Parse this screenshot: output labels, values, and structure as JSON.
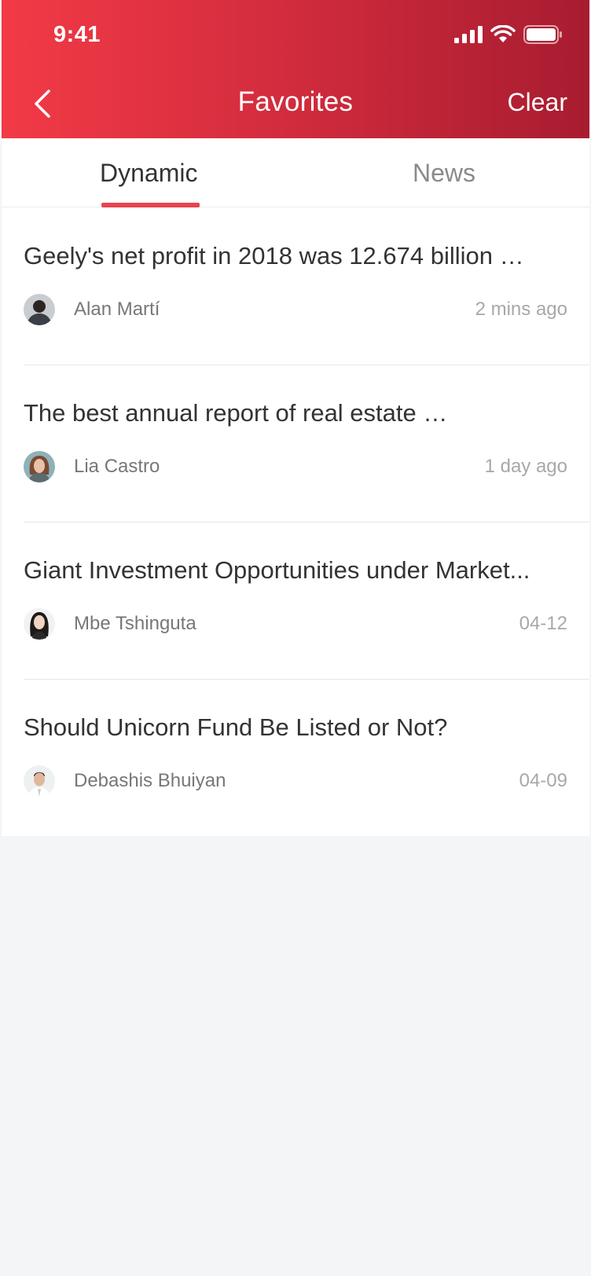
{
  "status_bar": {
    "time": "9:41"
  },
  "nav": {
    "title": "Favorites",
    "action": "Clear"
  },
  "tabs": [
    {
      "label": "Dynamic",
      "active": true
    },
    {
      "label": "News",
      "active": false
    }
  ],
  "items": [
    {
      "title": "Geely's net profit in 2018 was 12.674 billion …",
      "author": "Alan Martí",
      "time": "2 mins ago"
    },
    {
      "title": "The best annual report of real estate …",
      "author": "Lia Castro",
      "time": "1 day ago"
    },
    {
      "title": "Giant Investment Opportunities under Market...",
      "author": "Mbe Tshinguta",
      "time": "04-12"
    },
    {
      "title": "Should Unicorn Fund Be Listed or Not?",
      "author": "Debashis Bhuiyan",
      "time": "04-09"
    }
  ],
  "colors": {
    "header_start": "#f23a46",
    "header_end": "#a81c30",
    "accent": "#e8434f",
    "background": "#f4f5f7"
  }
}
